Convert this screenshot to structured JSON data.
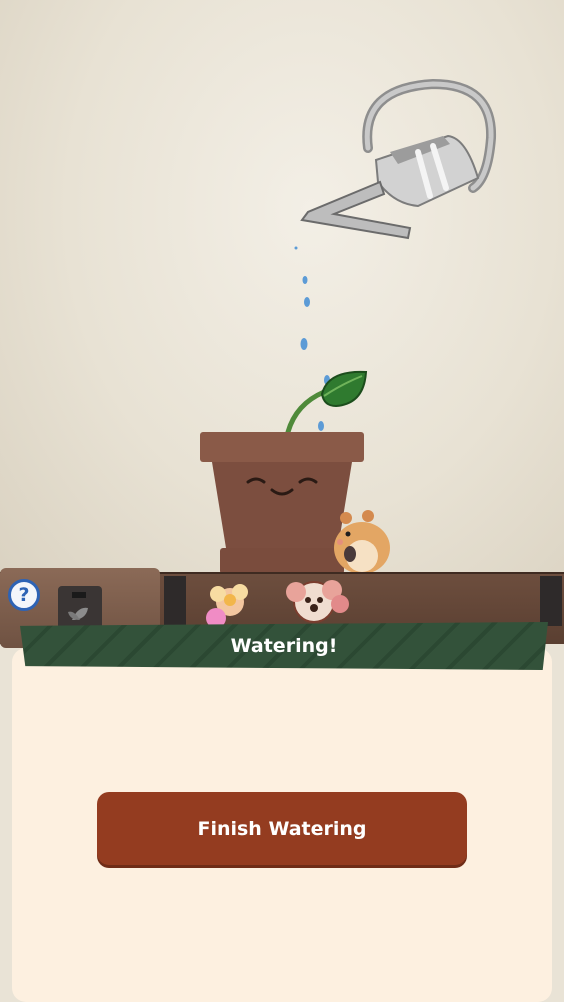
{
  "game": {
    "banner_title": "Watering!",
    "finish_button_label": "Finish Watering",
    "help_symbol": "?"
  },
  "icons": {
    "help": "question-mark-icon",
    "seed": "seed-bag-icon",
    "can": "watering-can-icon",
    "plant": "potted-sprout-icon",
    "hamster": "hamster-icon"
  },
  "colors": {
    "banner": "#33523a",
    "button": "#943c20",
    "panel": "#fdf0e0",
    "help_accent": "#2e63b5"
  }
}
